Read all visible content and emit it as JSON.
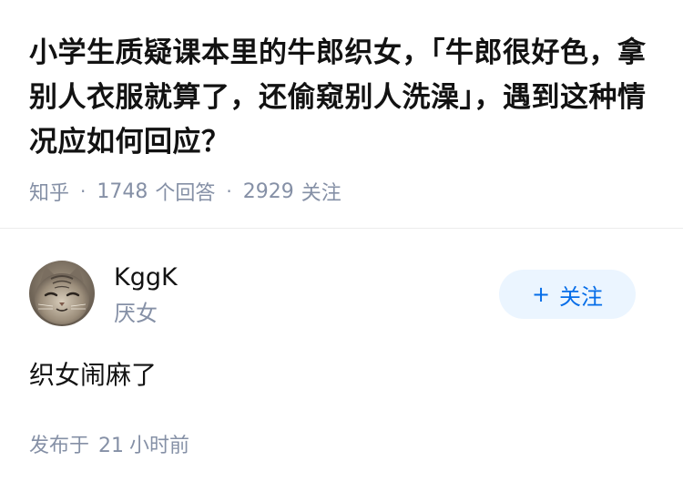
{
  "question": {
    "title": "小学生质疑课本里的牛郎织女，「牛郎很好色，拿别人衣服就算了，还偷窥别人洗澡」，遇到这种情况应如何回应？",
    "source": "知乎",
    "answer_count": "1748",
    "answer_label": "个回答",
    "follower_count": "2929",
    "follower_label": "关注"
  },
  "answer": {
    "author": {
      "name": "KggK",
      "bio": "厌女",
      "avatar_icon": "cat-avatar-icon"
    },
    "follow_button": {
      "icon": "plus-icon",
      "label": "关注"
    },
    "content": "织女闹麻了",
    "time_prefix": "发布于",
    "time_value": "21",
    "time_unit": "小时前"
  },
  "colors": {
    "title": "#121212",
    "meta": "#8590a6",
    "follow_bg": "#ebf5ff",
    "follow_text": "#056de8",
    "divider": "#ebebeb"
  }
}
